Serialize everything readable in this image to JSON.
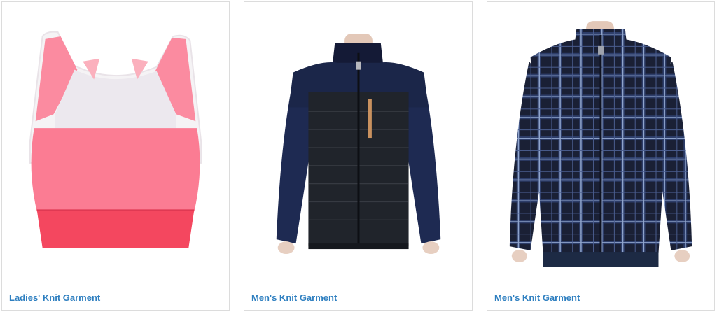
{
  "products": [
    {
      "label": "Ladies' Knit Garment",
      "image": "pink-crop-top-image"
    },
    {
      "label": "Men's Knit Garment",
      "image": "navy-quilted-jacket-image"
    },
    {
      "label": "Men's Knit Garment",
      "image": "plaid-fleece-jacket-image"
    }
  ],
  "colors": {
    "link": "#2e7fc0",
    "card_border": "#dcdcdc"
  }
}
